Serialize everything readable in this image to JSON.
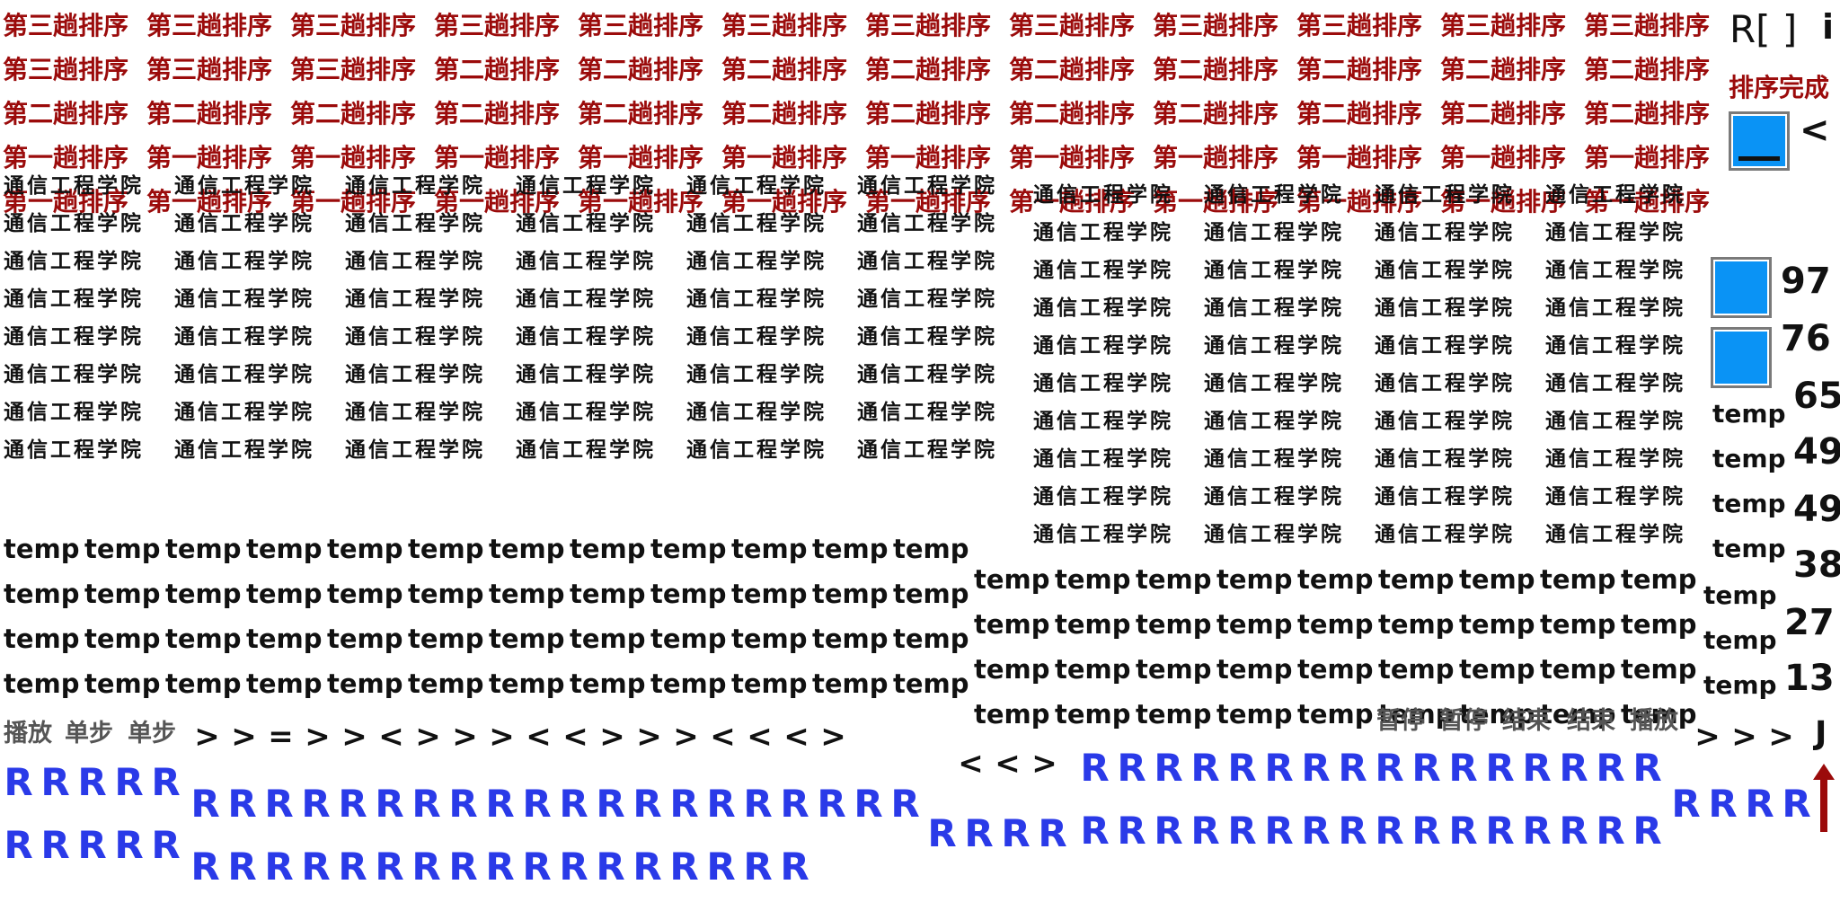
{
  "header": {
    "title_left": "R[ ]",
    "info": "i",
    "status": "排序完成",
    "compare_op": "<"
  },
  "pass_labels": {
    "third": "第三趟排序",
    "second": "第二趟排序",
    "first": "第一趟排序"
  },
  "college": "通信工程学院",
  "temp_label": "temp",
  "array_values": [
    "97",
    "76",
    "65",
    "49",
    "49",
    "38",
    "27",
    "13"
  ],
  "buttons": {
    "play": "播放",
    "step": "单步",
    "pause": "暂停",
    "end": "结束"
  },
  "ops_left": [
    ">",
    ">",
    "=",
    ">",
    ">",
    "<",
    ">",
    ">",
    ">",
    "<",
    "<",
    ">",
    ">",
    ">",
    "<",
    "<",
    "<",
    ">"
  ],
  "ops_mid": [
    "<",
    "<",
    ">"
  ],
  "ops_right": [
    ">",
    ">",
    ">"
  ],
  "pointer": "J",
  "r_glyph": "R",
  "colors": {
    "pass_text": "#9b0b0b",
    "r_text": "#2a3ae8",
    "square": "#0a93f5",
    "arrow": "#9b0b0b"
  }
}
